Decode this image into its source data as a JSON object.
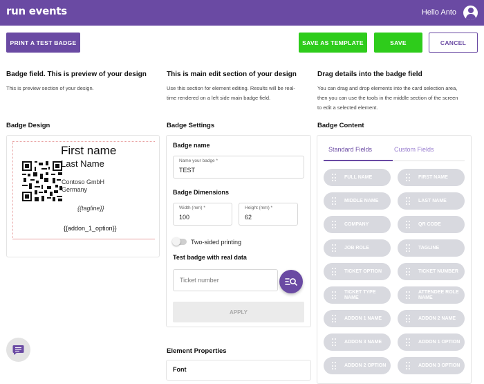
{
  "header": {
    "logo": "run events",
    "greeting": "Hello Anto"
  },
  "toolbar": {
    "print_label": "PRINT A TEST BADGE",
    "save_template_label": "SAVE AS TEMPLATE",
    "save_label": "SAVE",
    "cancel_label": "CANCEL"
  },
  "columns": {
    "left": {
      "title": "Badge field. This is preview of your design",
      "desc": "This is preview section of your design."
    },
    "middle": {
      "title": "This is main edit section of your design",
      "desc_1": "Use this section for element editing. Results will be real-",
      "desc_2": "time rendered on a left side main badge field."
    },
    "right": {
      "title": "Drag details into the badge field",
      "desc_1": "You can drag and drop elements into the card selection area,",
      "desc_2": "then you can use the tools in the middle section of the screen",
      "desc_3": "to edit a selected element."
    }
  },
  "badge_design": {
    "title": "Badge Design",
    "first_name": "First name",
    "last_name": "Last Name",
    "company": "Contoso GmbH",
    "country": "Germany",
    "tagline": "{{tagline}}",
    "addon": "{{addon_1_option}}"
  },
  "settings": {
    "title": "Badge Settings",
    "badge_name_heading": "Badge name",
    "badge_name_label": "Name your badge *",
    "badge_name_value": "TEST",
    "dimensions_heading": "Badge Dimensions",
    "width_label": "Width (mm) *",
    "width_value": "100",
    "height_label": "Height (mm) *",
    "height_value": "62",
    "two_sided_label": "Two-sided printing",
    "two_sided_on": false,
    "test_heading": "Test badge with real data",
    "ticket_placeholder": "Ticket number",
    "apply_label": "APPLY",
    "element_properties": "Element Properties",
    "font_label": "Font"
  },
  "content": {
    "title": "Badge Content",
    "tabs": [
      {
        "label": "Standard Fields",
        "active": true
      },
      {
        "label": "Custom Fields",
        "active": false
      }
    ],
    "chips": [
      "FULL NAME",
      "FIRST NAME",
      "MIDDLE NAME",
      "LAST NAME",
      "COMPANY",
      "QR CODE",
      "JOB ROLE",
      "TAGLINE",
      "TICKET OPTION",
      "TICKET NUMBER",
      "TICKET TYPE NAME",
      "ATTENDEE ROLE NAME",
      "ADDON 1 NAME",
      "ADDON 2 NAME",
      "ADDON 3 NAME",
      "ADDON 1 OPTION",
      "ADDON 2 OPTION",
      "ADDON 3 OPTION"
    ]
  },
  "colors": {
    "brand": "#6a4aa3",
    "success": "#2ecc1b",
    "chip": "#d8d9df"
  },
  "icons": {
    "avatar": "user-avatar-icon",
    "search": "search-list-icon",
    "chat": "chat-icon",
    "grip": "drag-handle-icon"
  }
}
